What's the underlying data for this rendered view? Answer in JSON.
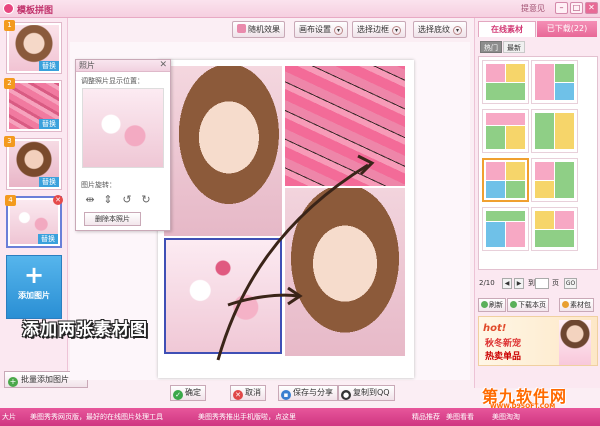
{
  "window": {
    "title": "模板拼图",
    "feedback": "提意见"
  },
  "left": {
    "thumbs": [
      {
        "num": "1",
        "replace": "替换"
      },
      {
        "num": "2",
        "replace": "替换"
      },
      {
        "num": "3",
        "replace": "替换"
      },
      {
        "num": "4",
        "replace": "替换"
      }
    ],
    "add_photo": "添加图片",
    "batch_add": "批量添加图片"
  },
  "toolbar": {
    "random": "随机效果",
    "layout": "画布设置",
    "border": "选择边框",
    "texture": "选择底纹"
  },
  "panel": {
    "title": "照片",
    "close": "✕",
    "adjust_label": "调整照片显示位置：",
    "rotate_label": "图片旋转：",
    "delete": "删除本照片"
  },
  "right": {
    "tab_online": "在线素材",
    "tab_downloaded": "已下载(22)",
    "sub_hot": "热门",
    "sub_new": "最新",
    "page_text": "2/10",
    "goto_to": "到",
    "goto_page": "页",
    "go": "GO",
    "refresh": "刷新",
    "download_page": "下载本页",
    "material_pack": "素材包",
    "ad_line1": "hot!",
    "ad_line2": "秋冬新宠",
    "ad_line3": "热卖单品"
  },
  "bottom": {
    "ok": "确定",
    "cancel": "取消",
    "save_share": "保存与分享",
    "copy_qq": "复制到QQ"
  },
  "status": {
    "s1": "大片",
    "s2": "美图秀秀网页版，最好的在线图片处理工具",
    "s3": "美图秀秀推出手机版啦，点这里",
    "s4": "精品推荐",
    "s5": "美图看看",
    "s6": "美图淘淘"
  },
  "watermark": {
    "big": "第九软件网",
    "url": "WWW.D9SOFT.COM"
  },
  "annotation": "添加两张素材图"
}
